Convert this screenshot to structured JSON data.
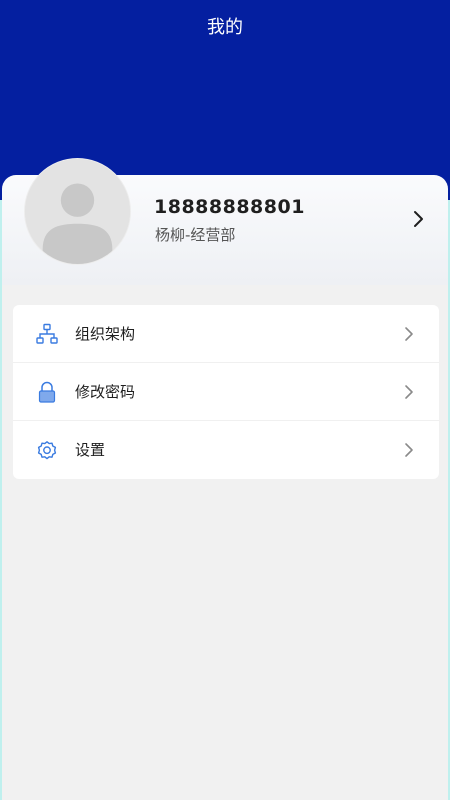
{
  "header": {
    "title": "我的"
  },
  "profile": {
    "phone": "18888888801",
    "department": "杨柳-经营部"
  },
  "menu": {
    "items": [
      {
        "label": "组织架构",
        "icon": "org-chart-icon"
      },
      {
        "label": "修改密码",
        "icon": "lock-icon"
      },
      {
        "label": "设置",
        "icon": "gear-icon"
      }
    ]
  },
  "colors": {
    "header_bg": "#041fa0",
    "icon_blue": "#3a7be0",
    "page_bg": "#f1f1f1"
  }
}
